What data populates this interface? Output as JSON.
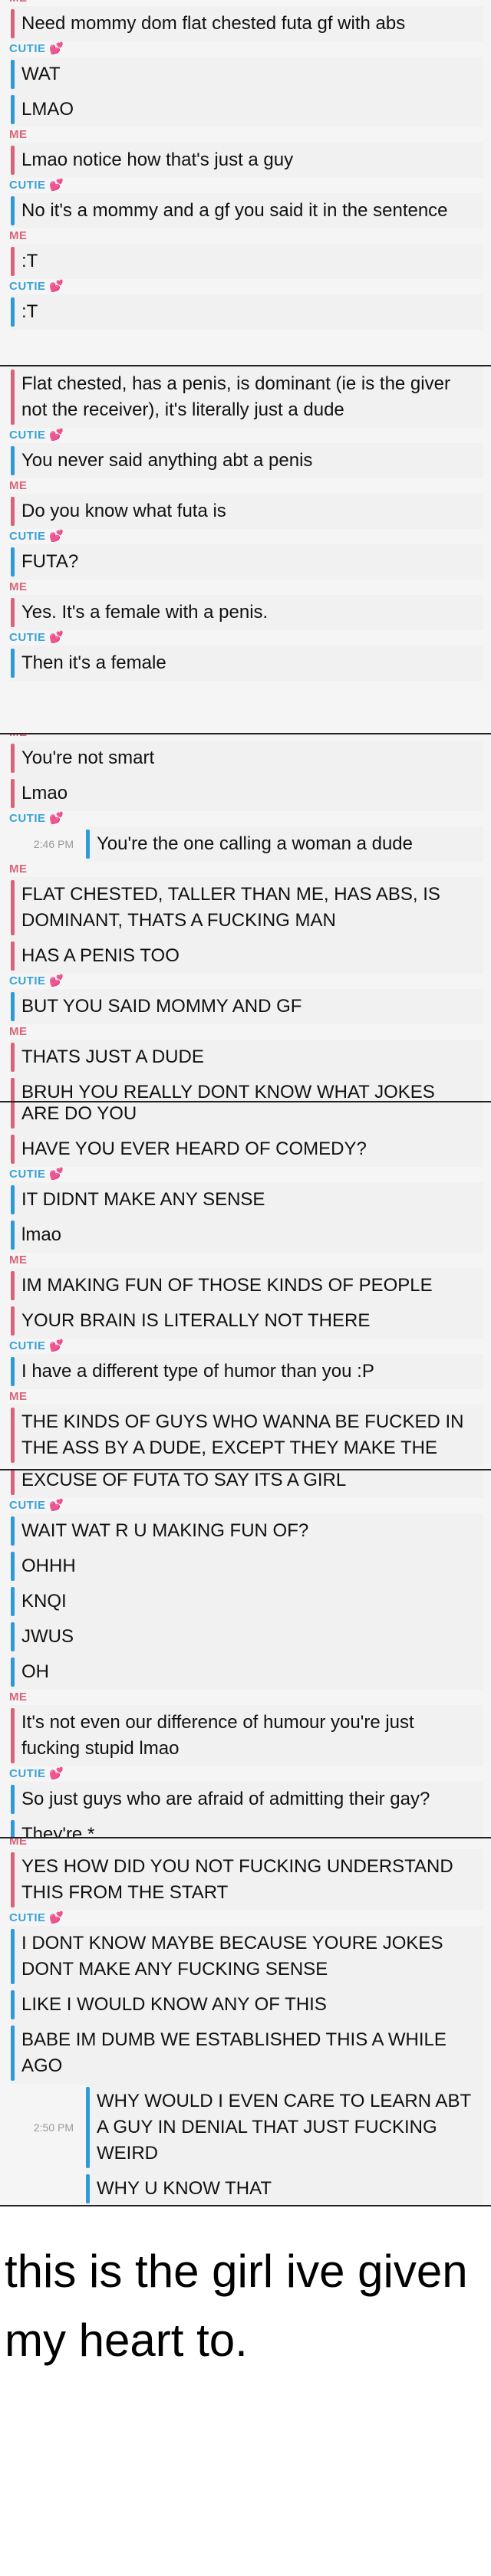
{
  "labels": {
    "me": "ME",
    "cutie": "CUTIE 💕"
  },
  "panel1": {
    "messages": [
      "Need mommy dom flat chested futa gf with abs",
      "WAT",
      "LMAO",
      "Lmao notice how that's just a guy",
      "No it's a mommy and a gf you said it in the sentence",
      ":T",
      ":T"
    ]
  },
  "panel2": {
    "messages": [
      "Flat chested, has a penis, is dominant (ie is the giver not the receiver), it's literally just a dude",
      "You never said anything abt a penis",
      "Do you know what futa is",
      "FUTA?",
      "Yes. It's a female with a penis.",
      "Then it's a female"
    ]
  },
  "panel3": {
    "messages": [
      "You're not smart",
      "Lmao",
      "You're the one calling a woman a dude",
      "FLAT CHESTED, TALLER THAN ME, HAS ABS, IS DOMINANT, THATS A FUCKING MAN",
      "HAS A PENIS TOO",
      "BUT YOU SAID MOMMY AND GF",
      "THATS JUST A DUDE",
      "BRUH YOU REALLY DONT KNOW WHAT JOKES"
    ],
    "time": "2:46 PM"
  },
  "panel4": {
    "messages": [
      "ARE DO YOU",
      "HAVE YOU EVER HEARD OF COMEDY?",
      "IT DIDNT MAKE ANY SENSE",
      "lmao",
      "IM MAKING FUN OF THOSE KINDS OF PEOPLE",
      "YOUR BRAIN IS LITERALLY NOT THERE",
      "I have a different type of humor than you :P",
      "THE KINDS OF GUYS WHO WANNA BE FUCKED IN THE ASS BY A DUDE, EXCEPT THEY MAKE THE"
    ]
  },
  "panel5": {
    "messages": [
      "EXCUSE OF FUTA TO SAY ITS A GIRL",
      "WAIT WAT R U MAKING FUN OF?",
      "OHHH",
      "KNQI",
      "JWUS",
      "OH",
      "It's not even our difference of humour you're just fucking stupid lmao",
      "So just guys who are afraid of admitting their gay?",
      "They're *"
    ]
  },
  "panel6": {
    "messages": [
      "YES HOW DID YOU NOT FUCKING UNDERSTAND THIS FROM THE START",
      "I DONT KNOW MAYBE BECAUSE YOURE JOKES DONT MAKE ANY FUCKING SENSE",
      "LIKE I WOULD KNOW ANY OF THIS",
      "BABE IM DUMB WE ESTABLISHED THIS A WHILE AGO",
      "WHY WOULD I EVEN CARE TO LEARN ABT A GUY IN DENIAL THAT JUST FUCKING WEIRD",
      "WHY U KNOW THAT"
    ],
    "time": "2:50 PM"
  },
  "caption": "this is the girl ive given my heart to."
}
